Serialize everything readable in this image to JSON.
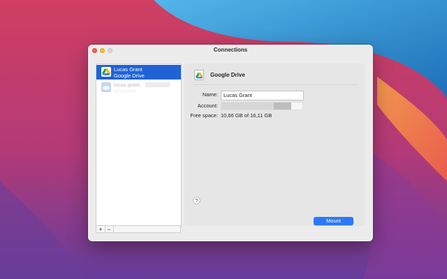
{
  "window": {
    "title": "Connections"
  },
  "sidebar": {
    "connections": [
      {
        "name": "Lucas Grant",
        "service": "Google Drive"
      },
      {
        "name": "lucas.grant.",
        "service": "OneDrive"
      }
    ],
    "add_label": "+",
    "remove_label": "−"
  },
  "detail": {
    "service_title": "Google Drive",
    "name_label": "Name:",
    "name_value": "Lucas Grant",
    "account_label": "Account:",
    "free_space_label": "Free space:",
    "free_space_value": "10,66 GB of 16,11 GB",
    "help_label": "?",
    "mount_label": "Mount"
  },
  "colors": {
    "selection": "#1f63d6",
    "mount_button": "#2d78f4"
  }
}
